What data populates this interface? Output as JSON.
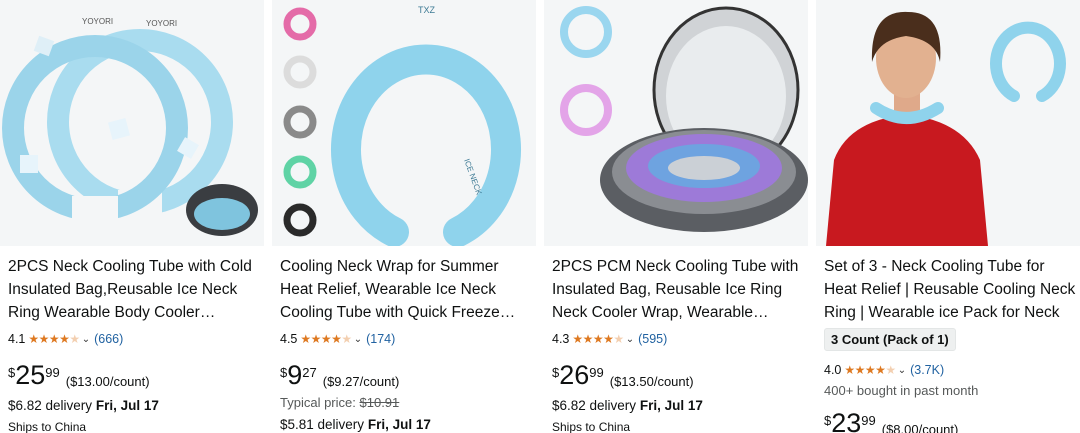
{
  "products": [
    {
      "title": "2PCS Neck Cooling Tube with Cold Insulated Bag,Reusable Ice Neck Ring Wearable Body Cooler Products for Summer Outdoor",
      "rating": "4.1",
      "stars": 4,
      "review_count": "(666)",
      "currency": "$",
      "price_whole": "25",
      "price_fraction": "99",
      "unit_price": "($13.00/count)",
      "delivery_prefix": "$6.82 delivery",
      "delivery_date": "Fri, Jul 17",
      "ships_to": "Ships to China",
      "image_text": [
        "YOYORI",
        "YOYORI"
      ]
    },
    {
      "title": "Cooling Neck Wrap for Summer Heat Relief, Wearable Ice Neck Cooling Tube with Quick Freeze Technology",
      "rating": "4.5",
      "stars": 4.5,
      "review_count": "(174)",
      "currency": "$",
      "price_whole": "9",
      "price_fraction": "27",
      "unit_price": "($9.27/count)",
      "typical_label": "Typical price:",
      "typical_price": "$10.91",
      "delivery_prefix": "$5.81 delivery",
      "delivery_date": "Fri, Jul 17",
      "image_text": [
        "TXZ",
        "ICE NECK"
      ]
    },
    {
      "title": "2PCS PCM Neck Cooling Tube with Insulated Bag, Reusable Ice Ring Neck Cooler Wrap, Wearable Cooling Products",
      "rating": "4.3",
      "stars": 4.5,
      "review_count": "(595)",
      "currency": "$",
      "price_whole": "26",
      "price_fraction": "99",
      "unit_price": "($13.50/count)",
      "delivery_prefix": "$6.82 delivery",
      "delivery_date": "Fri, Jul 17",
      "ships_to": "Ships to China"
    },
    {
      "title": "Set of 3 - Neck Cooling Tube for Heat Relief | Reusable Cooling Neck Ring | Wearable ice Pack for Neck",
      "badge": "3 Count (Pack of 1)",
      "rating": "4.0",
      "stars": 4,
      "review_count": "(3.7K)",
      "bought": "400+ bought in past month",
      "currency": "$",
      "price_whole": "23",
      "price_fraction": "99",
      "unit_price": "($8.00/count)"
    }
  ],
  "colors": {
    "star": "#de7921",
    "link": "#2162a1",
    "text": "#0f1111",
    "muted": "#565959",
    "ring_blue": "#8fd3ec"
  }
}
